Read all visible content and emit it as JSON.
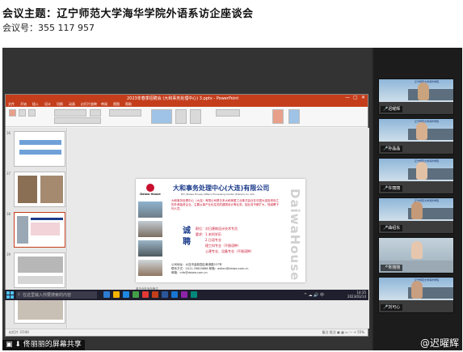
{
  "header": {
    "title": "会议主题：辽宁师范大学海华学院外语系访企座谈会",
    "meeting_id": "会议号：355 117 957"
  },
  "ppt": {
    "window_title": "2023年春季招聘会 (大和事务处理中心) 3.pptx - PowerPoint",
    "tabs": [
      "文件",
      "开始",
      "插入",
      "设计",
      "切换",
      "动画",
      "幻灯片放映",
      "审阅",
      "视图",
      "帮助"
    ],
    "slide_numbers": [
      "36",
      "37",
      "38",
      "39"
    ],
    "notes_placeholder": "单击此处添加备注",
    "status_left": "幻灯片 37/40",
    "status_right": "备注  批注  ▣  ▦  ▭  —  +  55%"
  },
  "slide": {
    "logo_text": "Daiwa House",
    "company": "大和事务处理中心(大连)有限公司",
    "company_en": "DH (Daiwa House) Affairs Processing Center (Dalian) Co.,Ltd.",
    "intro": "大和事务处理中心（大连）有限公司是日本大和房屋工业株式会社在中国大连投资设立的外商独资企业。主要从事产业化住宅的建筑设计等业务。因业务不断扩大，现诚聘下列人员。",
    "zhao": "诚聘",
    "jobs": [
      "职位：对日建筑设计技术专员",
      "要求：1.本科学历",
      "2.日语专业",
      "理工科专业（不限语种）",
      "土建专业、设备专业（不限语种）"
    ],
    "contact": [
      "公司地址：大连市高新园区黄浦路537号",
      "联系方式：0411-39800888    邮箱：dalian@daiwa.com.cn",
      "邮箱：info@daiwa.com.cn"
    ],
    "brand_vertical": "DaiwaHouse"
  },
  "taskbar": {
    "search_placeholder": "在这里输入你要搜索的内容",
    "tray_left": "^ ☁ 🔊 中",
    "time": "14:35",
    "date": "2023/03/14"
  },
  "participants": [
    {
      "name": "迟曜辉",
      "face_color": "#c9a27e",
      "bg": "#6a6f77"
    },
    {
      "name": "孙晶晶",
      "face_color": "#d7b08f",
      "bg": "#7a6a5a"
    },
    {
      "name": "许丽丽",
      "face_color": "#e2c2a6",
      "bg": "#8a8a8a"
    },
    {
      "name": "曲绍东",
      "face_color": "#c59a78",
      "bg": "#515a63"
    },
    {
      "name": "佟丽丽",
      "face_color": "#e6c7ae",
      "bg": "#b9c7d1"
    },
    {
      "name": "刘可心",
      "face_color": "#c89f80",
      "bg": "#66727c"
    }
  ],
  "share_label": "佟丽丽的屏幕共享",
  "watermark": "@迟曜辉",
  "colors": {
    "ppt_red": "#c43e1c",
    "daiwa_red": "#c8102e",
    "navy": "#1a3b8a"
  }
}
